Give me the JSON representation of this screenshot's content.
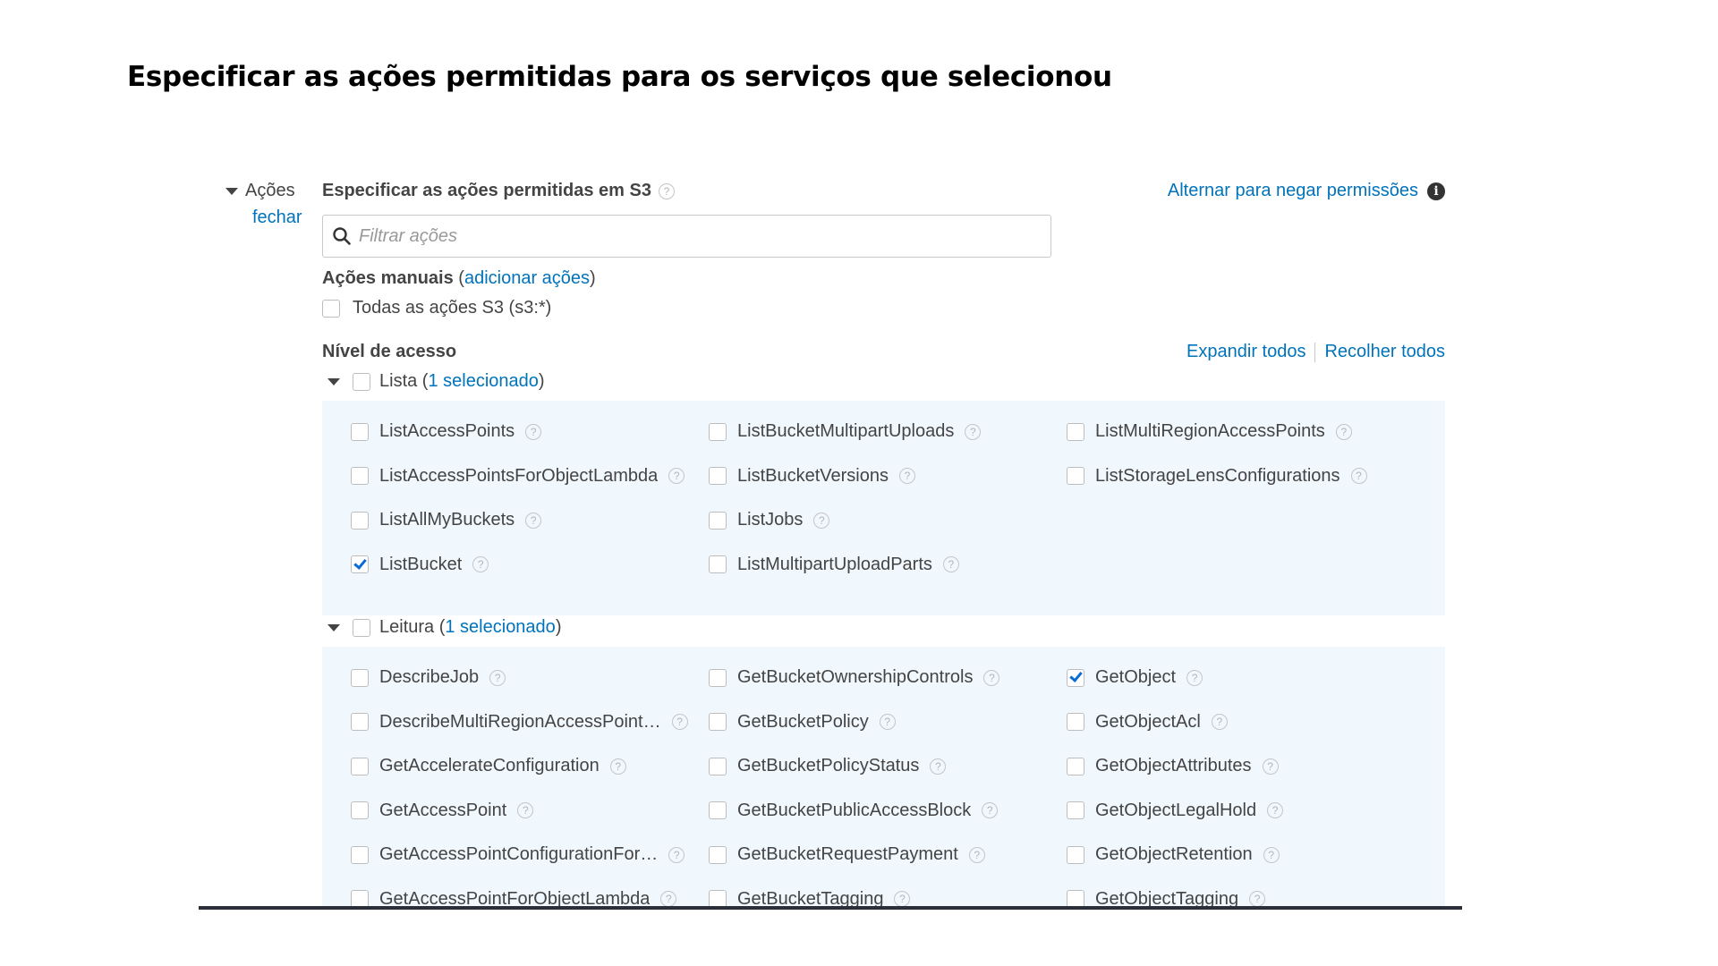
{
  "page_heading": "Especificar as ações permitidas para os serviços que selecionou",
  "actions_label": "Ações",
  "close_label": "fechar",
  "section_title": "Especificar as ações permitidas em S3",
  "deny_link": "Alternar para negar permissões",
  "filter_placeholder": "Filtrar ações",
  "manual_actions": {
    "label": "Ações manuais",
    "open_paren": " (",
    "link": "adicionar ações",
    "close_paren": ")"
  },
  "all_actions_label": "Todas as ações S3 (s3:*)",
  "access_level_title": "Nível de acesso",
  "expand_all": "Expandir todos",
  "collapse_all": "Recolher todos",
  "groups": [
    {
      "name": "Lista",
      "open_paren": " (",
      "selected_text": "1 selecionado",
      "close_paren": ")",
      "columns": [
        [
          {
            "name": "ListAccessPoints",
            "checked": false
          },
          {
            "name": "ListAccessPointsForObjectLambda",
            "checked": false
          },
          {
            "name": "ListAllMyBuckets",
            "checked": false
          },
          {
            "name": "ListBucket",
            "checked": true
          }
        ],
        [
          {
            "name": "ListBucketMultipartUploads",
            "checked": false
          },
          {
            "name": "ListBucketVersions",
            "checked": false
          },
          {
            "name": "ListJobs",
            "checked": false
          },
          {
            "name": "ListMultipartUploadParts",
            "checked": false
          }
        ],
        [
          {
            "name": "ListMultiRegionAccessPoints",
            "checked": false
          },
          {
            "name": "ListStorageLensConfigurations",
            "checked": false
          }
        ]
      ]
    },
    {
      "name": "Leitura",
      "open_paren": " (",
      "selected_text": "1 selecionado",
      "close_paren": ")",
      "columns": [
        [
          {
            "name": "DescribeJob",
            "checked": false
          },
          {
            "name": "DescribeMultiRegionAccessPoint…",
            "checked": false
          },
          {
            "name": "GetAccelerateConfiguration",
            "checked": false
          },
          {
            "name": "GetAccessPoint",
            "checked": false
          },
          {
            "name": "GetAccessPointConfigurationFor…",
            "checked": false
          },
          {
            "name": "GetAccessPointForObjectLambda",
            "checked": false
          }
        ],
        [
          {
            "name": "GetBucketOwnershipControls",
            "checked": false
          },
          {
            "name": "GetBucketPolicy",
            "checked": false
          },
          {
            "name": "GetBucketPolicyStatus",
            "checked": false
          },
          {
            "name": "GetBucketPublicAccessBlock",
            "checked": false
          },
          {
            "name": "GetBucketRequestPayment",
            "checked": false
          },
          {
            "name": "GetBucketTagging",
            "checked": false
          }
        ],
        [
          {
            "name": "GetObject",
            "checked": true
          },
          {
            "name": "GetObjectAcl",
            "checked": false
          },
          {
            "name": "GetObjectAttributes",
            "checked": false
          },
          {
            "name": "GetObjectLegalHold",
            "checked": false
          },
          {
            "name": "GetObjectRetention",
            "checked": false
          },
          {
            "name": "GetObjectTagging",
            "checked": false
          }
        ]
      ]
    }
  ]
}
